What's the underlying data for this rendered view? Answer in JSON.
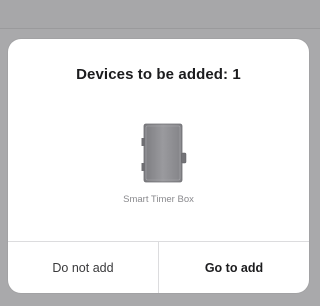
{
  "dialog": {
    "title": "Devices to be added: 1",
    "device": {
      "name": "Smart Timer Box",
      "icon": "timer-box-device-icon"
    },
    "buttons": {
      "cancel_label": "Do not add",
      "confirm_label": "Go to add"
    }
  },
  "colors": {
    "backdrop": "#a9a9ab",
    "dialog_bg": "#ffffff",
    "title_text": "#1c1c1e",
    "secondary_text": "#8a8a8e",
    "divider": "#dcdcde",
    "device_body": "#8e8e92"
  }
}
